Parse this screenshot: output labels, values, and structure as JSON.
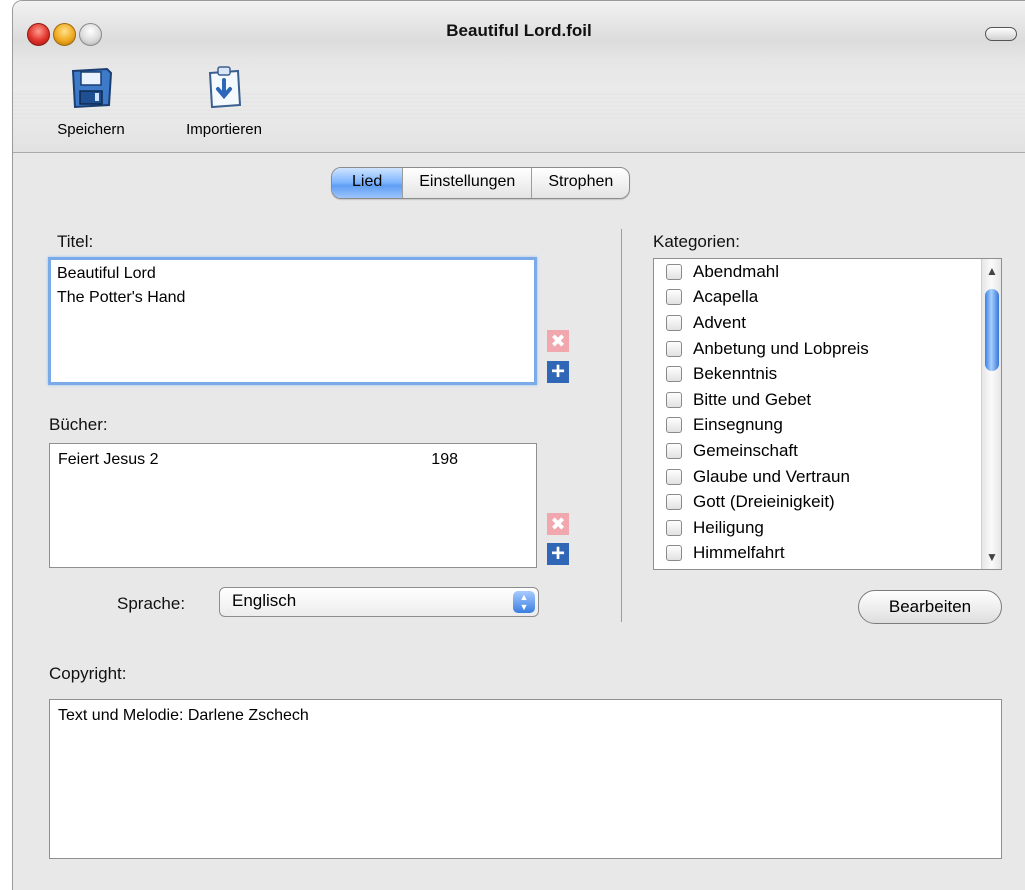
{
  "window": {
    "title": "Beautiful Lord.foil"
  },
  "toolbar": {
    "save_label": "Speichern",
    "save_icon": "floppy-disk-icon",
    "import_label": "Importieren",
    "import_icon": "import-clipboard-icon"
  },
  "tabs": [
    {
      "label": "Lied",
      "active": true
    },
    {
      "label": "Einstellungen",
      "active": false
    },
    {
      "label": "Strophen",
      "active": false
    }
  ],
  "song": {
    "title_label": "Titel:",
    "titles": [
      "Beautiful Lord",
      "The Potter's Hand"
    ],
    "books_label": "Bücher:",
    "books": [
      {
        "name": "Feiert Jesus 2",
        "number": "198"
      }
    ],
    "language_label": "Sprache:",
    "language_value": "Englisch",
    "remove_symbol": "✖",
    "add_symbol": "+"
  },
  "categories": {
    "label": "Kategorien:",
    "items": [
      "Abendmahl",
      "Acapella",
      "Advent",
      "Anbetung und Lobpreis",
      "Bekenntnis",
      "Bitte und Gebet",
      "Einsegnung",
      "Gemeinschaft",
      "Glaube und Vertraun",
      "Gott (Dreieinigkeit)",
      "Heiligung",
      "Himmelfahrt"
    ],
    "edit_button": "Bearbeiten"
  },
  "copyright": {
    "label": "Copyright:",
    "value": "Text und Melodie: Darlene Zschech"
  },
  "colors": {
    "accent": "#5f9ef4",
    "add_button": "#2f66b6",
    "remove_button": "#f0a7ae"
  }
}
